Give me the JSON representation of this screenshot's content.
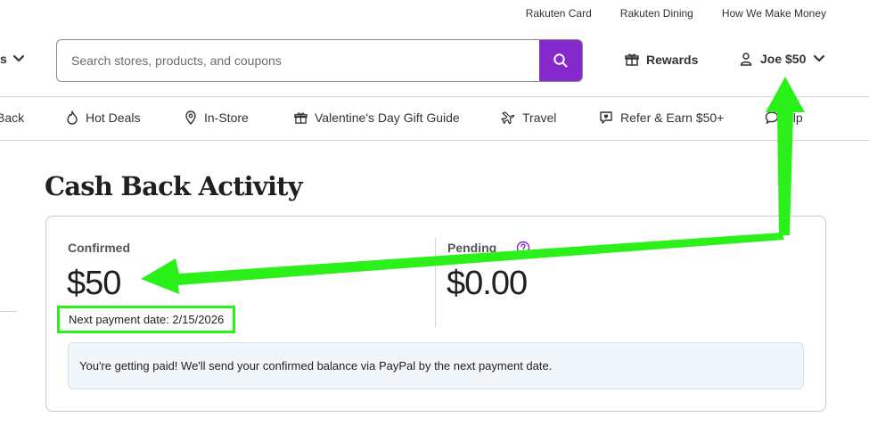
{
  "top_links": [
    "Rakuten Card",
    "Rakuten Dining",
    "How We Make Money"
  ],
  "header": {
    "stores_fragment": "s",
    "search_placeholder": "Search stores, products, and coupons",
    "rewards_label": "Rewards",
    "account_label": "Joe $50"
  },
  "nav": {
    "items": [
      {
        "label": "Back",
        "icon": "none"
      },
      {
        "label": "Hot Deals",
        "icon": "fire-icon"
      },
      {
        "label": "In-Store",
        "icon": "location-pin-icon"
      },
      {
        "label": "Valentine's Day Gift Guide",
        "icon": "gift-icon"
      },
      {
        "label": "Travel",
        "icon": "plane-icon"
      },
      {
        "label": "Refer & Earn $50+",
        "icon": "chat-heart-icon"
      },
      {
        "label": "elp",
        "icon": "chat-bubble-icon"
      }
    ]
  },
  "page": {
    "title": "Cash Back Activity"
  },
  "card": {
    "confirmed_label": "Confirmed",
    "confirmed_amount": "$50",
    "pending_label": "Pending",
    "pending_amount": "$0.00",
    "next_payment": "Next payment date: 2/15/2026",
    "banner": "You're getting paid! We'll send your confirmed balance via PayPal by the next payment date."
  },
  "colors": {
    "accent_purple": "#8529cd",
    "annotation_green": "#2bf01a"
  }
}
